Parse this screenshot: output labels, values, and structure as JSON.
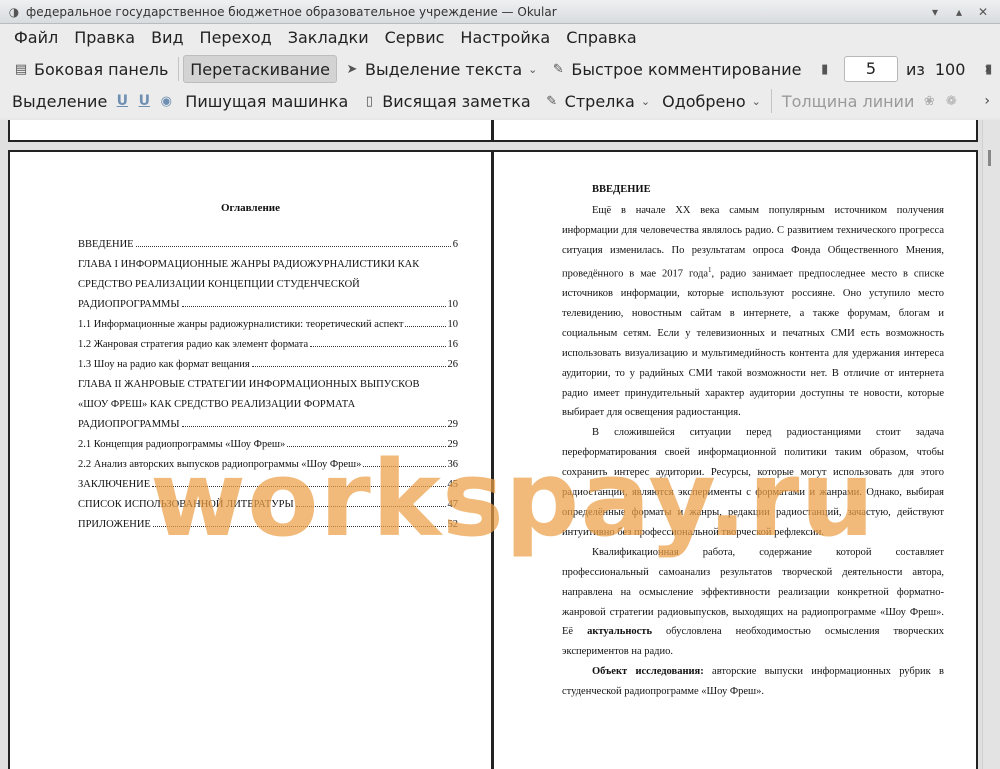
{
  "window": {
    "title": "федеральное государственное бюджетное образовательное учреждение  — Okular"
  },
  "menu": [
    "Файл",
    "Правка",
    "Вид",
    "Переход",
    "Закладки",
    "Сервис",
    "Настройка",
    "Справка"
  ],
  "toolbar1": {
    "sidebar": "Боковая панель",
    "drag": "Перетаскивание",
    "text_select": "Выделение текста",
    "quick_comment": "Быстрое комментирование",
    "page_current": "5",
    "page_of": "из",
    "page_total": "100"
  },
  "toolbar2": {
    "selection": "Выделение",
    "typewriter": "Пишущая машинка",
    "sticky_note": "Висящая заметка",
    "arrow": "Стрелка",
    "approved": "Одобрено",
    "line_width": "Толщина линии"
  },
  "left_page": {
    "heading": "Оглавление",
    "toc": [
      {
        "text": "ВВЕДЕНИЕ",
        "page": "6"
      },
      {
        "text": "ГЛАВА I ИНФОРМАЦИОННЫЕ ЖАНРЫ РАДИОЖУРНАЛИСТИКИ КАК",
        "page": ""
      },
      {
        "text": "СРЕДСТВО РЕАЛИЗАЦИИ КОНЦЕПЦИИ СТУДЕНЧЕСКОЙ",
        "page": ""
      },
      {
        "text": "РАДИОПРОГРАММЫ",
        "page": "10"
      },
      {
        "text": "1.1 Информационные жанры радиожурналистики: теоретический аспект",
        "page": "10"
      },
      {
        "text": "1.2  Жанровая стратегия радио как элемент формата",
        "page": "16"
      },
      {
        "text": "1.3  Шоу на радио как формат вещания",
        "page": "26"
      },
      {
        "text": "ГЛАВА II ЖАНРОВЫЕ СТРАТЕГИИ ИНФОРМАЦИОННЫХ ВЫПУСКОВ",
        "page": ""
      },
      {
        "text": "«ШОУ ФРЕШ» КАК СРЕДСТВО РЕАЛИЗАЦИИ ФОРМАТА",
        "page": ""
      },
      {
        "text": "РАДИОПРОГРАММЫ",
        "page": "29"
      },
      {
        "text": "2.1   Концепция радиопрограммы «Шоу Фреш»",
        "page": "29"
      },
      {
        "text": "2.2   Анализ авторских выпусков радиопрограммы «Шоу Фреш»",
        "page": "36"
      },
      {
        "text": "ЗАКЛЮЧЕНИЕ",
        "page": "45"
      },
      {
        "text": "СПИСОК ИСПОЛЬЗОВАННОЙ ЛИТЕРАТУРЫ",
        "page": "47"
      },
      {
        "text": "ПРИЛОЖЕНИЕ",
        "page": "52"
      }
    ]
  },
  "right_page": {
    "heading": "ВВЕДЕНИЕ",
    "p1_a": "Ещё в начале XX века самым популярным источником получения информации для человечества являлось радио. С развитием технического прогресса ситуация изменилась. По результатам опроса Фонда Общественного Мнения, проведённого в мае 2017 года",
    "p1_sup": "1",
    "p1_b": ", радио занимает предпоследнее место в списке источников информации, которые используют россияне. Оно уступило место телевидению, новостным сайтам в интернете, а также форумам, блогам и социальным сетям. Если у телевизионных и печатных СМИ есть возможность использовать визуализацию и мультимедийность контента для удержания интереса аудитории, то у радийных СМИ такой возможности нет. В отличие от интернета радио имеет принудительный характер аудитории доступны те новости, которые выбирает для освещения радиостанция.",
    "p2": "В сложившейся ситуации перед радиостанциями стоит задача переформатирования своей информационной политики таким образом, чтобы сохранить интерес аудитории. Ресурсы, которые могут использовать для этого радиостанции, являются эксперименты с форматами и жанрами. Однако, выбирая определённые форматы и жанры, редакции радиостанций, зачастую, действуют интуитивно без профессиональной творческой рефлексии.",
    "p3_a": "Квалификационная работа, содержание которой составляет профессиональный самоанализ результатов творческой деятельности автора, направлена на осмысление эффективности реализации конкретной форматно-жанровой стратегии радиовыпусков, выходящих на радиопрограмме «Шоу Фреш». Её ",
    "p3_bold": "актуальность",
    "p3_b": " обусловлена необходимостью осмысления творческих экспериментов на радио.",
    "p4_bold": "Объект исследования:",
    "p4_b": " авторские выпуски информационных рубрик в студенческой радиопрограмме «Шоу Фреш»."
  },
  "watermark": "workspay.ru"
}
